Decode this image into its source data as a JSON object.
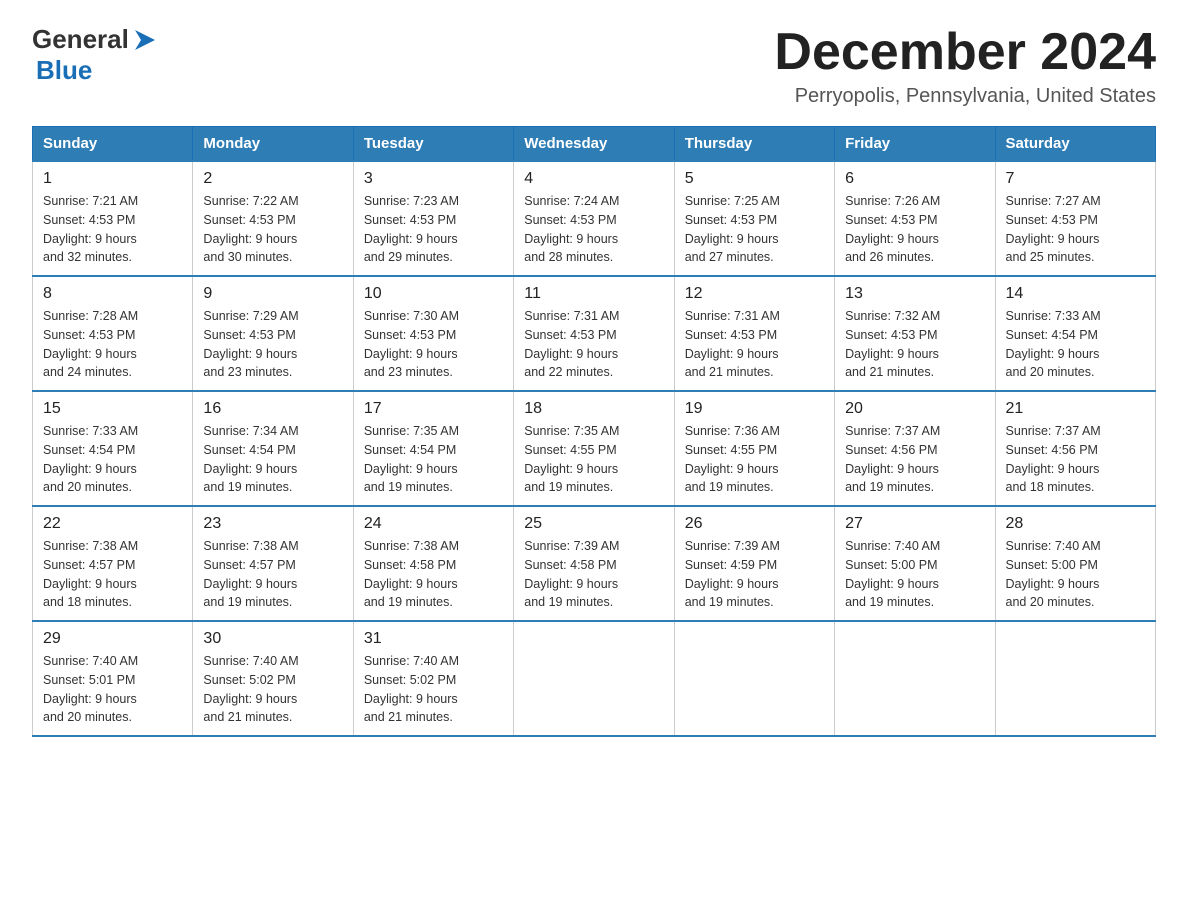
{
  "logo": {
    "text_general": "General",
    "text_blue": "Blue",
    "arrow_color": "#1a6eb5"
  },
  "header": {
    "month_title": "December 2024",
    "location": "Perryopolis, Pennsylvania, United States"
  },
  "weekdays": [
    "Sunday",
    "Monday",
    "Tuesday",
    "Wednesday",
    "Thursday",
    "Friday",
    "Saturday"
  ],
  "weeks": [
    [
      {
        "day": "1",
        "sunrise": "7:21 AM",
        "sunset": "4:53 PM",
        "daylight": "9 hours and 32 minutes."
      },
      {
        "day": "2",
        "sunrise": "7:22 AM",
        "sunset": "4:53 PM",
        "daylight": "9 hours and 30 minutes."
      },
      {
        "day": "3",
        "sunrise": "7:23 AM",
        "sunset": "4:53 PM",
        "daylight": "9 hours and 29 minutes."
      },
      {
        "day": "4",
        "sunrise": "7:24 AM",
        "sunset": "4:53 PM",
        "daylight": "9 hours and 28 minutes."
      },
      {
        "day": "5",
        "sunrise": "7:25 AM",
        "sunset": "4:53 PM",
        "daylight": "9 hours and 27 minutes."
      },
      {
        "day": "6",
        "sunrise": "7:26 AM",
        "sunset": "4:53 PM",
        "daylight": "9 hours and 26 minutes."
      },
      {
        "day": "7",
        "sunrise": "7:27 AM",
        "sunset": "4:53 PM",
        "daylight": "9 hours and 25 minutes."
      }
    ],
    [
      {
        "day": "8",
        "sunrise": "7:28 AM",
        "sunset": "4:53 PM",
        "daylight": "9 hours and 24 minutes."
      },
      {
        "day": "9",
        "sunrise": "7:29 AM",
        "sunset": "4:53 PM",
        "daylight": "9 hours and 23 minutes."
      },
      {
        "day": "10",
        "sunrise": "7:30 AM",
        "sunset": "4:53 PM",
        "daylight": "9 hours and 23 minutes."
      },
      {
        "day": "11",
        "sunrise": "7:31 AM",
        "sunset": "4:53 PM",
        "daylight": "9 hours and 22 minutes."
      },
      {
        "day": "12",
        "sunrise": "7:31 AM",
        "sunset": "4:53 PM",
        "daylight": "9 hours and 21 minutes."
      },
      {
        "day": "13",
        "sunrise": "7:32 AM",
        "sunset": "4:53 PM",
        "daylight": "9 hours and 21 minutes."
      },
      {
        "day": "14",
        "sunrise": "7:33 AM",
        "sunset": "4:54 PM",
        "daylight": "9 hours and 20 minutes."
      }
    ],
    [
      {
        "day": "15",
        "sunrise": "7:33 AM",
        "sunset": "4:54 PM",
        "daylight": "9 hours and 20 minutes."
      },
      {
        "day": "16",
        "sunrise": "7:34 AM",
        "sunset": "4:54 PM",
        "daylight": "9 hours and 19 minutes."
      },
      {
        "day": "17",
        "sunrise": "7:35 AM",
        "sunset": "4:54 PM",
        "daylight": "9 hours and 19 minutes."
      },
      {
        "day": "18",
        "sunrise": "7:35 AM",
        "sunset": "4:55 PM",
        "daylight": "9 hours and 19 minutes."
      },
      {
        "day": "19",
        "sunrise": "7:36 AM",
        "sunset": "4:55 PM",
        "daylight": "9 hours and 19 minutes."
      },
      {
        "day": "20",
        "sunrise": "7:37 AM",
        "sunset": "4:56 PM",
        "daylight": "9 hours and 19 minutes."
      },
      {
        "day": "21",
        "sunrise": "7:37 AM",
        "sunset": "4:56 PM",
        "daylight": "9 hours and 18 minutes."
      }
    ],
    [
      {
        "day": "22",
        "sunrise": "7:38 AM",
        "sunset": "4:57 PM",
        "daylight": "9 hours and 18 minutes."
      },
      {
        "day": "23",
        "sunrise": "7:38 AM",
        "sunset": "4:57 PM",
        "daylight": "9 hours and 19 minutes."
      },
      {
        "day": "24",
        "sunrise": "7:38 AM",
        "sunset": "4:58 PM",
        "daylight": "9 hours and 19 minutes."
      },
      {
        "day": "25",
        "sunrise": "7:39 AM",
        "sunset": "4:58 PM",
        "daylight": "9 hours and 19 minutes."
      },
      {
        "day": "26",
        "sunrise": "7:39 AM",
        "sunset": "4:59 PM",
        "daylight": "9 hours and 19 minutes."
      },
      {
        "day": "27",
        "sunrise": "7:40 AM",
        "sunset": "5:00 PM",
        "daylight": "9 hours and 19 minutes."
      },
      {
        "day": "28",
        "sunrise": "7:40 AM",
        "sunset": "5:00 PM",
        "daylight": "9 hours and 20 minutes."
      }
    ],
    [
      {
        "day": "29",
        "sunrise": "7:40 AM",
        "sunset": "5:01 PM",
        "daylight": "9 hours and 20 minutes."
      },
      {
        "day": "30",
        "sunrise": "7:40 AM",
        "sunset": "5:02 PM",
        "daylight": "9 hours and 21 minutes."
      },
      {
        "day": "31",
        "sunrise": "7:40 AM",
        "sunset": "5:02 PM",
        "daylight": "9 hours and 21 minutes."
      },
      null,
      null,
      null,
      null
    ]
  ],
  "labels": {
    "sunrise": "Sunrise:",
    "sunset": "Sunset:",
    "daylight": "Daylight:"
  }
}
